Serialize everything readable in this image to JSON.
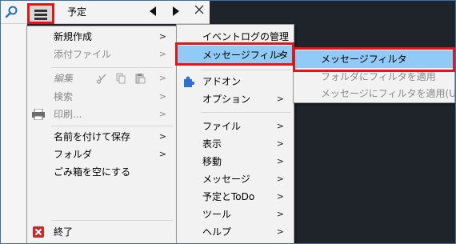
{
  "topbar": {
    "tab_title": "予定"
  },
  "main_menu": {
    "items": [
      {
        "label": "新規作成",
        "enabled": true,
        "submenu": true
      },
      {
        "label": "添付ファイル",
        "enabled": false,
        "submenu": true
      },
      {
        "label": "編集",
        "enabled": false,
        "submenu": true
      },
      {
        "label": "検索",
        "enabled": false,
        "submenu": true
      },
      {
        "label": "印刷...",
        "enabled": false,
        "submenu": true
      },
      {
        "label": "名前を付けて保存",
        "enabled": true,
        "submenu": true
      },
      {
        "label": "フォルダ",
        "enabled": true,
        "submenu": true
      },
      {
        "label": "ごみ箱を空にする",
        "enabled": true,
        "submenu": false
      },
      {
        "label": "終了",
        "enabled": true,
        "submenu": false
      }
    ]
  },
  "sub_menu": {
    "items": [
      {
        "label": "イベントログの管理",
        "submenu": false
      },
      {
        "label": "メッセージフィルタ",
        "submenu": true,
        "highlighted": true
      },
      {
        "label": "アドオン",
        "submenu": false
      },
      {
        "label": "オプション",
        "submenu": true
      },
      {
        "label": "ファイル",
        "submenu": true
      },
      {
        "label": "表示",
        "submenu": true
      },
      {
        "label": "移動",
        "submenu": true
      },
      {
        "label": "メッセージ",
        "submenu": true
      },
      {
        "label": "予定とToDo",
        "submenu": true
      },
      {
        "label": "ツール",
        "submenu": true
      },
      {
        "label": "ヘルプ",
        "submenu": true
      }
    ]
  },
  "third_menu": {
    "items": [
      {
        "label": "メッセージフィルタ",
        "enabled": true,
        "highlighted": true
      },
      {
        "label": "フォルダにフィルタを適用",
        "enabled": false
      },
      {
        "label": "メッセージにフィルタを適用(U)",
        "enabled": false
      }
    ]
  },
  "colors": {
    "highlight": "#91c9f7",
    "annotation_red": "#e0161b",
    "menu_bg": "#f2f2f2",
    "disabled_text": "#8a8a8a"
  },
  "icons": {
    "search": "search-icon",
    "menu": "hamburger-menu-icon",
    "prev": "triangle-left-icon",
    "next": "triangle-right-icon",
    "close": "close-icon",
    "cut": "scissors-icon",
    "copy": "copy-icon",
    "paste": "paste-icon",
    "print": "printer-icon",
    "addon": "puzzle-piece-icon",
    "exit": "exit-icon"
  }
}
